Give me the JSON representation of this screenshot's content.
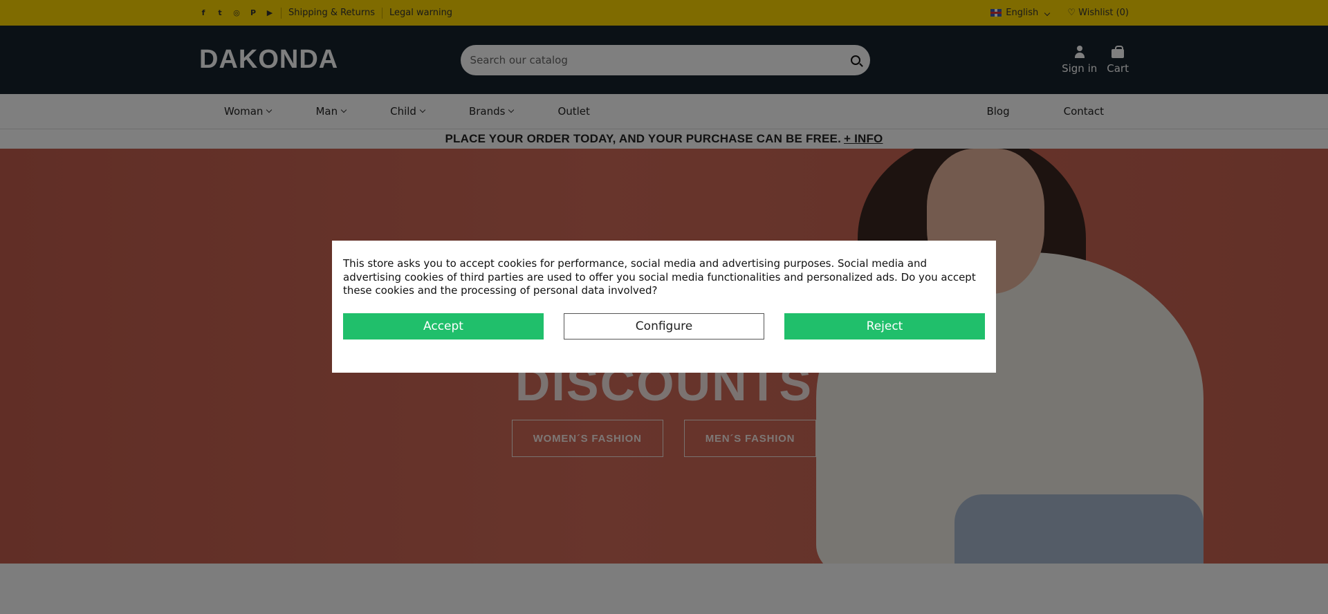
{
  "topbar": {
    "social_icons": [
      "facebook-icon",
      "twitter-icon",
      "instagram-icon",
      "pinterest-icon",
      "youtube-icon"
    ],
    "links": [
      "Shipping & Returns",
      "Legal warning"
    ],
    "language": "English",
    "wishlist": "Wishlist (0)",
    "bg_color": "#fed700"
  },
  "header": {
    "logo": "DAKONDA",
    "search_placeholder": "Search our catalog",
    "sign_in": "Sign in",
    "cart": "Cart",
    "bg_color": "#17232c"
  },
  "nav": {
    "left": [
      "Woman",
      "Man",
      "Child",
      "Brands",
      "Outlet"
    ],
    "right": [
      "Blog",
      "Contact"
    ]
  },
  "promo": {
    "text": "PLACE YOUR ORDER TODAY, AND YOUR PURCHASE CAN BE FREE.",
    "link": "+ INFO"
  },
  "hero": {
    "title": "DISCOUNTS",
    "buttons": [
      "WOMEN´S FASHION",
      "MEN´S FASHION"
    ]
  },
  "cookie_modal": {
    "message": "This store asks you to accept cookies for performance, social media and advertising purposes. Social media and advertising cookies of third parties are used to offer you social media functionalities and personalized ads. Do you accept these cookies and the processing of personal data involved?",
    "accept": "Accept",
    "configure": "Configure",
    "reject": "Reject",
    "accent_color": "#20bf6b"
  }
}
